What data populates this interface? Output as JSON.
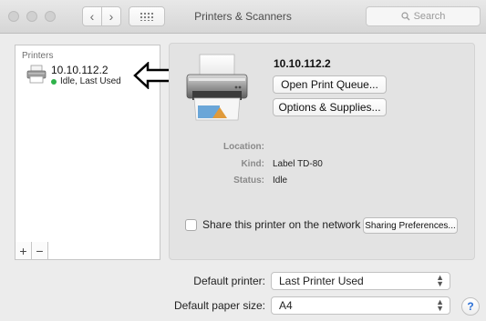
{
  "window": {
    "title": "Printers & Scanners",
    "search_placeholder": "Search",
    "back_label": "‹",
    "forward_label": "›"
  },
  "printer_list": {
    "heading": "Printers",
    "items": [
      {
        "name": "10.10.112.2",
        "status": "Idle, Last Used",
        "status_color": "#2fb24a",
        "selected": true
      }
    ],
    "add_label": "+",
    "remove_label": "−"
  },
  "detail": {
    "printer_name": "10.10.112.2",
    "open_queue_label": "Open Print Queue...",
    "options_supplies_label": "Options & Supplies...",
    "fields": [
      {
        "label": "Location:",
        "value": ""
      },
      {
        "label": "Kind:",
        "value": "Label TD-80"
      },
      {
        "label": "Status:",
        "value": "Idle"
      }
    ],
    "share_label": "Share this printer on the network",
    "share_checked": false,
    "sharing_prefs_label": "Sharing Preferences..."
  },
  "defaults": {
    "printer_label": "Default printer:",
    "printer_value": "Last Printer Used",
    "paper_label": "Default paper size:",
    "paper_value": "A4"
  },
  "help_label": "?",
  "icons": [
    "close-icon",
    "minimize-icon",
    "zoom-icon",
    "back-icon",
    "forward-icon",
    "show-all-icon",
    "search-icon",
    "printer-icon",
    "annotation-arrow-icon",
    "popup-arrows-icon",
    "help-icon"
  ]
}
